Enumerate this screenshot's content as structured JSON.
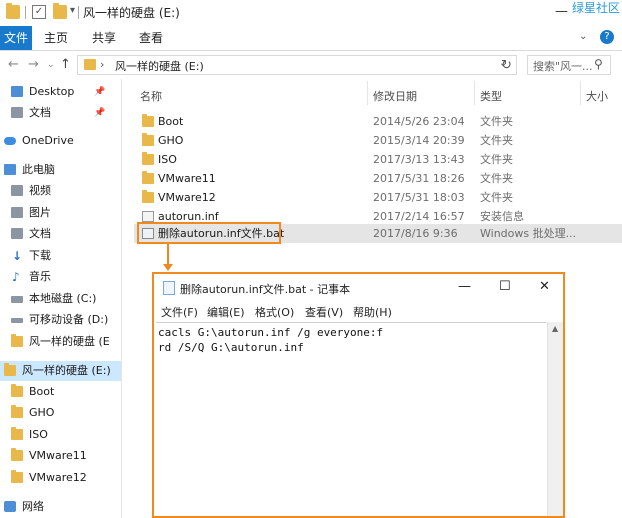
{
  "titlebar": {
    "title": "风一样的硬盘 (E:)",
    "minimize": "—",
    "watermark": "绿星社区",
    "qa_dropdown": "▾",
    "qa_check": "✓"
  },
  "ribbon": {
    "tabs": [
      "文件",
      "主页",
      "共享",
      "查看"
    ],
    "collapse": "⌄",
    "help": "?"
  },
  "address": {
    "back": "←",
    "forward": "→",
    "up": "↑",
    "separator": "›",
    "path": "风一样的硬盘 (E:)",
    "dropdown": "⌄",
    "refresh": "↻",
    "search_placeholder": "搜索\"风一...",
    "search_icon": "⚲"
  },
  "sidebar": {
    "pin": "📌",
    "items": [
      {
        "label": "Desktop",
        "icon": "desktop-icon",
        "pinned": true
      },
      {
        "label": "文档",
        "icon": "documents-icon",
        "pinned": true
      },
      {
        "label": "OneDrive",
        "icon": "onedrive-icon"
      },
      {
        "label": "此电脑",
        "icon": "this-pc-icon"
      },
      {
        "label": "视频",
        "icon": "video-icon"
      },
      {
        "label": "图片",
        "icon": "pictures-icon"
      },
      {
        "label": "文档",
        "icon": "documents-icon"
      },
      {
        "label": "下载",
        "icon": "download-icon"
      },
      {
        "label": "音乐",
        "icon": "music-icon"
      },
      {
        "label": "本地磁盘 (C:)",
        "icon": "drive-icon"
      },
      {
        "label": "可移动设备 (D:)",
        "icon": "removable-drive-icon"
      },
      {
        "label": "风一样的硬盘 (E",
        "icon": "drive-icon"
      },
      {
        "label": "风一样的硬盘 (E:)",
        "icon": "drive-icon",
        "selected": true
      },
      {
        "label": "Boot",
        "icon": "folder-icon"
      },
      {
        "label": "GHO",
        "icon": "folder-icon"
      },
      {
        "label": "ISO",
        "icon": "folder-icon"
      },
      {
        "label": "VMware11",
        "icon": "folder-icon"
      },
      {
        "label": "VMware12",
        "icon": "folder-icon"
      },
      {
        "label": "网络",
        "icon": "network-icon"
      }
    ]
  },
  "columns": {
    "name": "名称",
    "date": "修改日期",
    "type": "类型",
    "size": "大小"
  },
  "files": [
    {
      "name": "Boot",
      "date": "2014/5/26 23:04",
      "type": "文件夹",
      "icon": "folder-icon"
    },
    {
      "name": "GHO",
      "date": "2015/3/14 20:39",
      "type": "文件夹",
      "icon": "folder-icon"
    },
    {
      "name": "ISO",
      "date": "2017/3/13 13:43",
      "type": "文件夹",
      "icon": "folder-icon"
    },
    {
      "name": "VMware11",
      "date": "2017/5/31 18:26",
      "type": "文件夹",
      "icon": "folder-icon"
    },
    {
      "name": "VMware12",
      "date": "2017/5/31 18:03",
      "type": "文件夹",
      "icon": "folder-icon"
    },
    {
      "name": "autorun.inf",
      "date": "2017/2/14 16:57",
      "type": "安装信息",
      "icon": "inf-file-icon"
    },
    {
      "name": "删除autorun.inf文件.bat",
      "date": "2017/8/16 9:36",
      "type": "Windows 批处理...",
      "icon": "bat-file-icon",
      "selected": true
    }
  ],
  "notepad": {
    "title": "删除autorun.inf文件.bat - 记事本",
    "minimize": "—",
    "maximize": "☐",
    "close": "✕",
    "menu": [
      "文件(F)",
      "编辑(E)",
      "格式(O)",
      "查看(V)",
      "帮助(H)"
    ],
    "lines": [
      "cacls G:\\autorun.inf /g everyone:f",
      "rd /S/Q G:\\autorun.inf"
    ],
    "scroll_up": "▲"
  },
  "colors": {
    "accent": "#1979ca",
    "highlight": "#f08a1f",
    "selection": "#cce8ff",
    "folder": "#e8b84a"
  }
}
